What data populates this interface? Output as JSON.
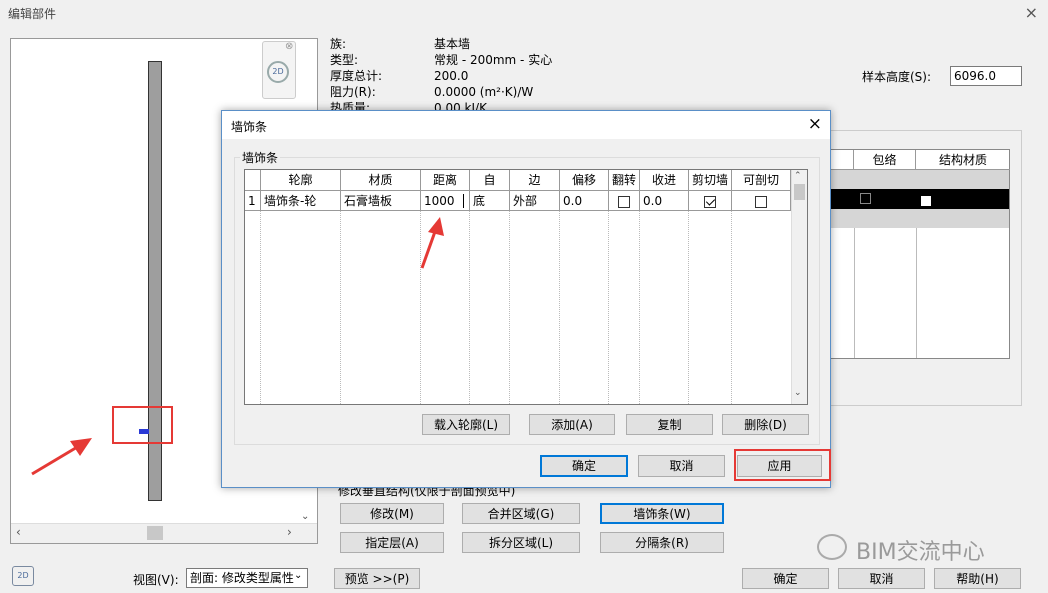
{
  "main_window": {
    "title": "编辑部件",
    "close": "×"
  },
  "info": {
    "family_label": "族:",
    "family_value": "基本墙",
    "type_label": "类型:",
    "type_value": "常规 - 200mm - 实心",
    "thickness_label": "厚度总计:",
    "thickness_value": "200.0",
    "resistance_label": "阻力(R):",
    "resistance_value": "0.0000 (m²·K)/W",
    "thermal_label": "热质量:",
    "thermal_value": "0.00 kJ/K"
  },
  "sample_height": {
    "label": "样本高度(S):",
    "value": "6096.0"
  },
  "layers_table": {
    "headers": [
      "包络",
      "结构材质"
    ]
  },
  "preview_nav": {
    "badge": "2D"
  },
  "vertical_structure": {
    "caption": "修改垂直结构(仅限于剖面预览中)",
    "buttons": [
      "修改(M)",
      "合并区域(G)",
      "墙饰条(W)",
      "指定层(A)",
      "拆分区域(L)",
      "分隔条(R)"
    ]
  },
  "bottom": {
    "view_label": "视图(V):",
    "view_value": "剖面: 修改类型属性",
    "preview_button": "预览 >>(P)",
    "ok": "确定",
    "cancel": "取消",
    "help": "帮助(H)"
  },
  "dialog": {
    "title": "墙饰条",
    "close": "×",
    "group_label": "墙饰条",
    "columns": [
      "轮廓",
      "材质",
      "距离",
      "自",
      "边",
      "偏移",
      "翻转",
      "收进",
      "剪切墙",
      "可剖切"
    ],
    "rows": [
      {
        "num": "1",
        "profile": "墙饰条-轮",
        "material": "石膏墙板",
        "distance": "1000",
        "from": "底",
        "side": "外部",
        "offset": "0.0",
        "flip": false,
        "setback": "0.0",
        "cuts_wall": true,
        "cuttable": false
      }
    ],
    "buttons": {
      "load_profile": "载入轮廓(L)",
      "add": "添加(A)",
      "copy": "复制",
      "delete": "删除(D)"
    },
    "footer": {
      "ok": "确定",
      "cancel": "取消",
      "apply": "应用"
    }
  },
  "watermark": "BIM交流中心",
  "colors": {
    "annotation": "#e53935",
    "dialog_border": "#5a8fc7",
    "button_focus": "#0078d7"
  }
}
